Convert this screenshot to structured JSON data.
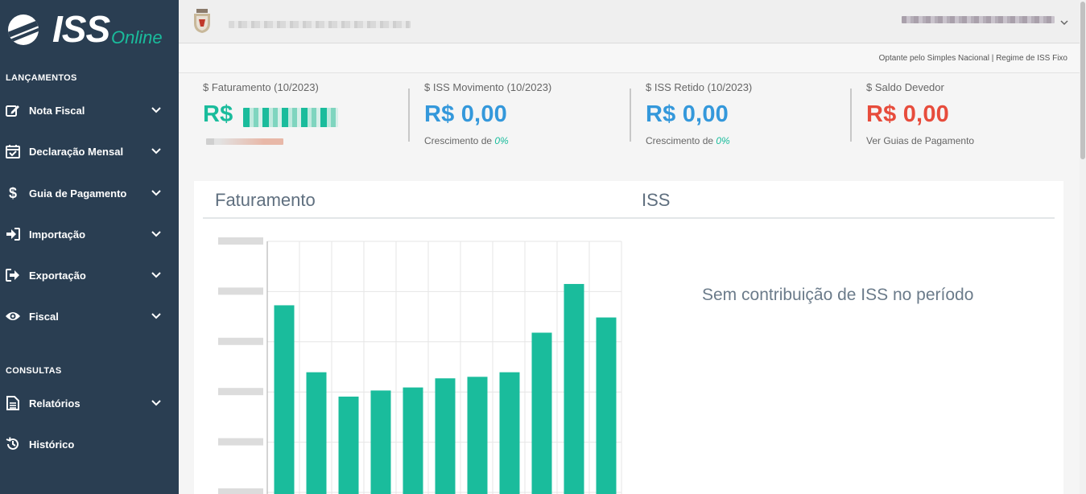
{
  "app": {
    "brand_main": "ISS",
    "brand_sub": "Online"
  },
  "sidebar": {
    "sections": [
      {
        "title": "LANÇAMENTOS"
      },
      {
        "title": "CONSULTAS"
      }
    ],
    "items": [
      {
        "label": "Nota Fiscal",
        "icon": "edit-icon"
      },
      {
        "label": "Declaração Mensal",
        "icon": "calendar-check-icon"
      },
      {
        "label": "Guia de Pagamento",
        "icon": "dollar-icon"
      },
      {
        "label": "Importação",
        "icon": "sign-in-icon"
      },
      {
        "label": "Exportação",
        "icon": "sign-out-icon"
      },
      {
        "label": "Fiscal",
        "icon": "eye-icon"
      },
      {
        "label": "Relatórios",
        "icon": "file-text-icon"
      },
      {
        "label": "Histórico",
        "icon": "history-icon"
      }
    ]
  },
  "header": {
    "regime_text": "Optante pelo Simples Nacional | Regime de ISS Fixo"
  },
  "stats": [
    {
      "label": "$ Faturamento (10/2023)",
      "value": "R$",
      "color": "#1abc9c"
    },
    {
      "label": "$ ISS Movimento (10/2023)",
      "value": "R$ 0,00",
      "sub_prefix": "Crescimento de ",
      "sub_pct": "0%",
      "color": "#3498db"
    },
    {
      "label": "$ ISS Retido (10/2023)",
      "value": "R$ 0,00",
      "sub_prefix": "Crescimento de ",
      "sub_pct": "0%",
      "color": "#3498db"
    },
    {
      "label": "$ Saldo Devedor",
      "value": "R$ 0,00",
      "sub_link": "Ver Guias de Pagamento",
      "color": "#e74c3c"
    }
  ],
  "panel": {
    "faturamento_title": "Faturamento",
    "iss_title": "ISS",
    "empty_message": "Sem contribuição de ISS no período"
  },
  "chart_data": {
    "type": "bar",
    "bar_color": "#1abc9c",
    "values": [
      62,
      40,
      32,
      34,
      35,
      38,
      38.5,
      40,
      53,
      69,
      58
    ],
    "ylim": [
      0,
      83
    ]
  }
}
